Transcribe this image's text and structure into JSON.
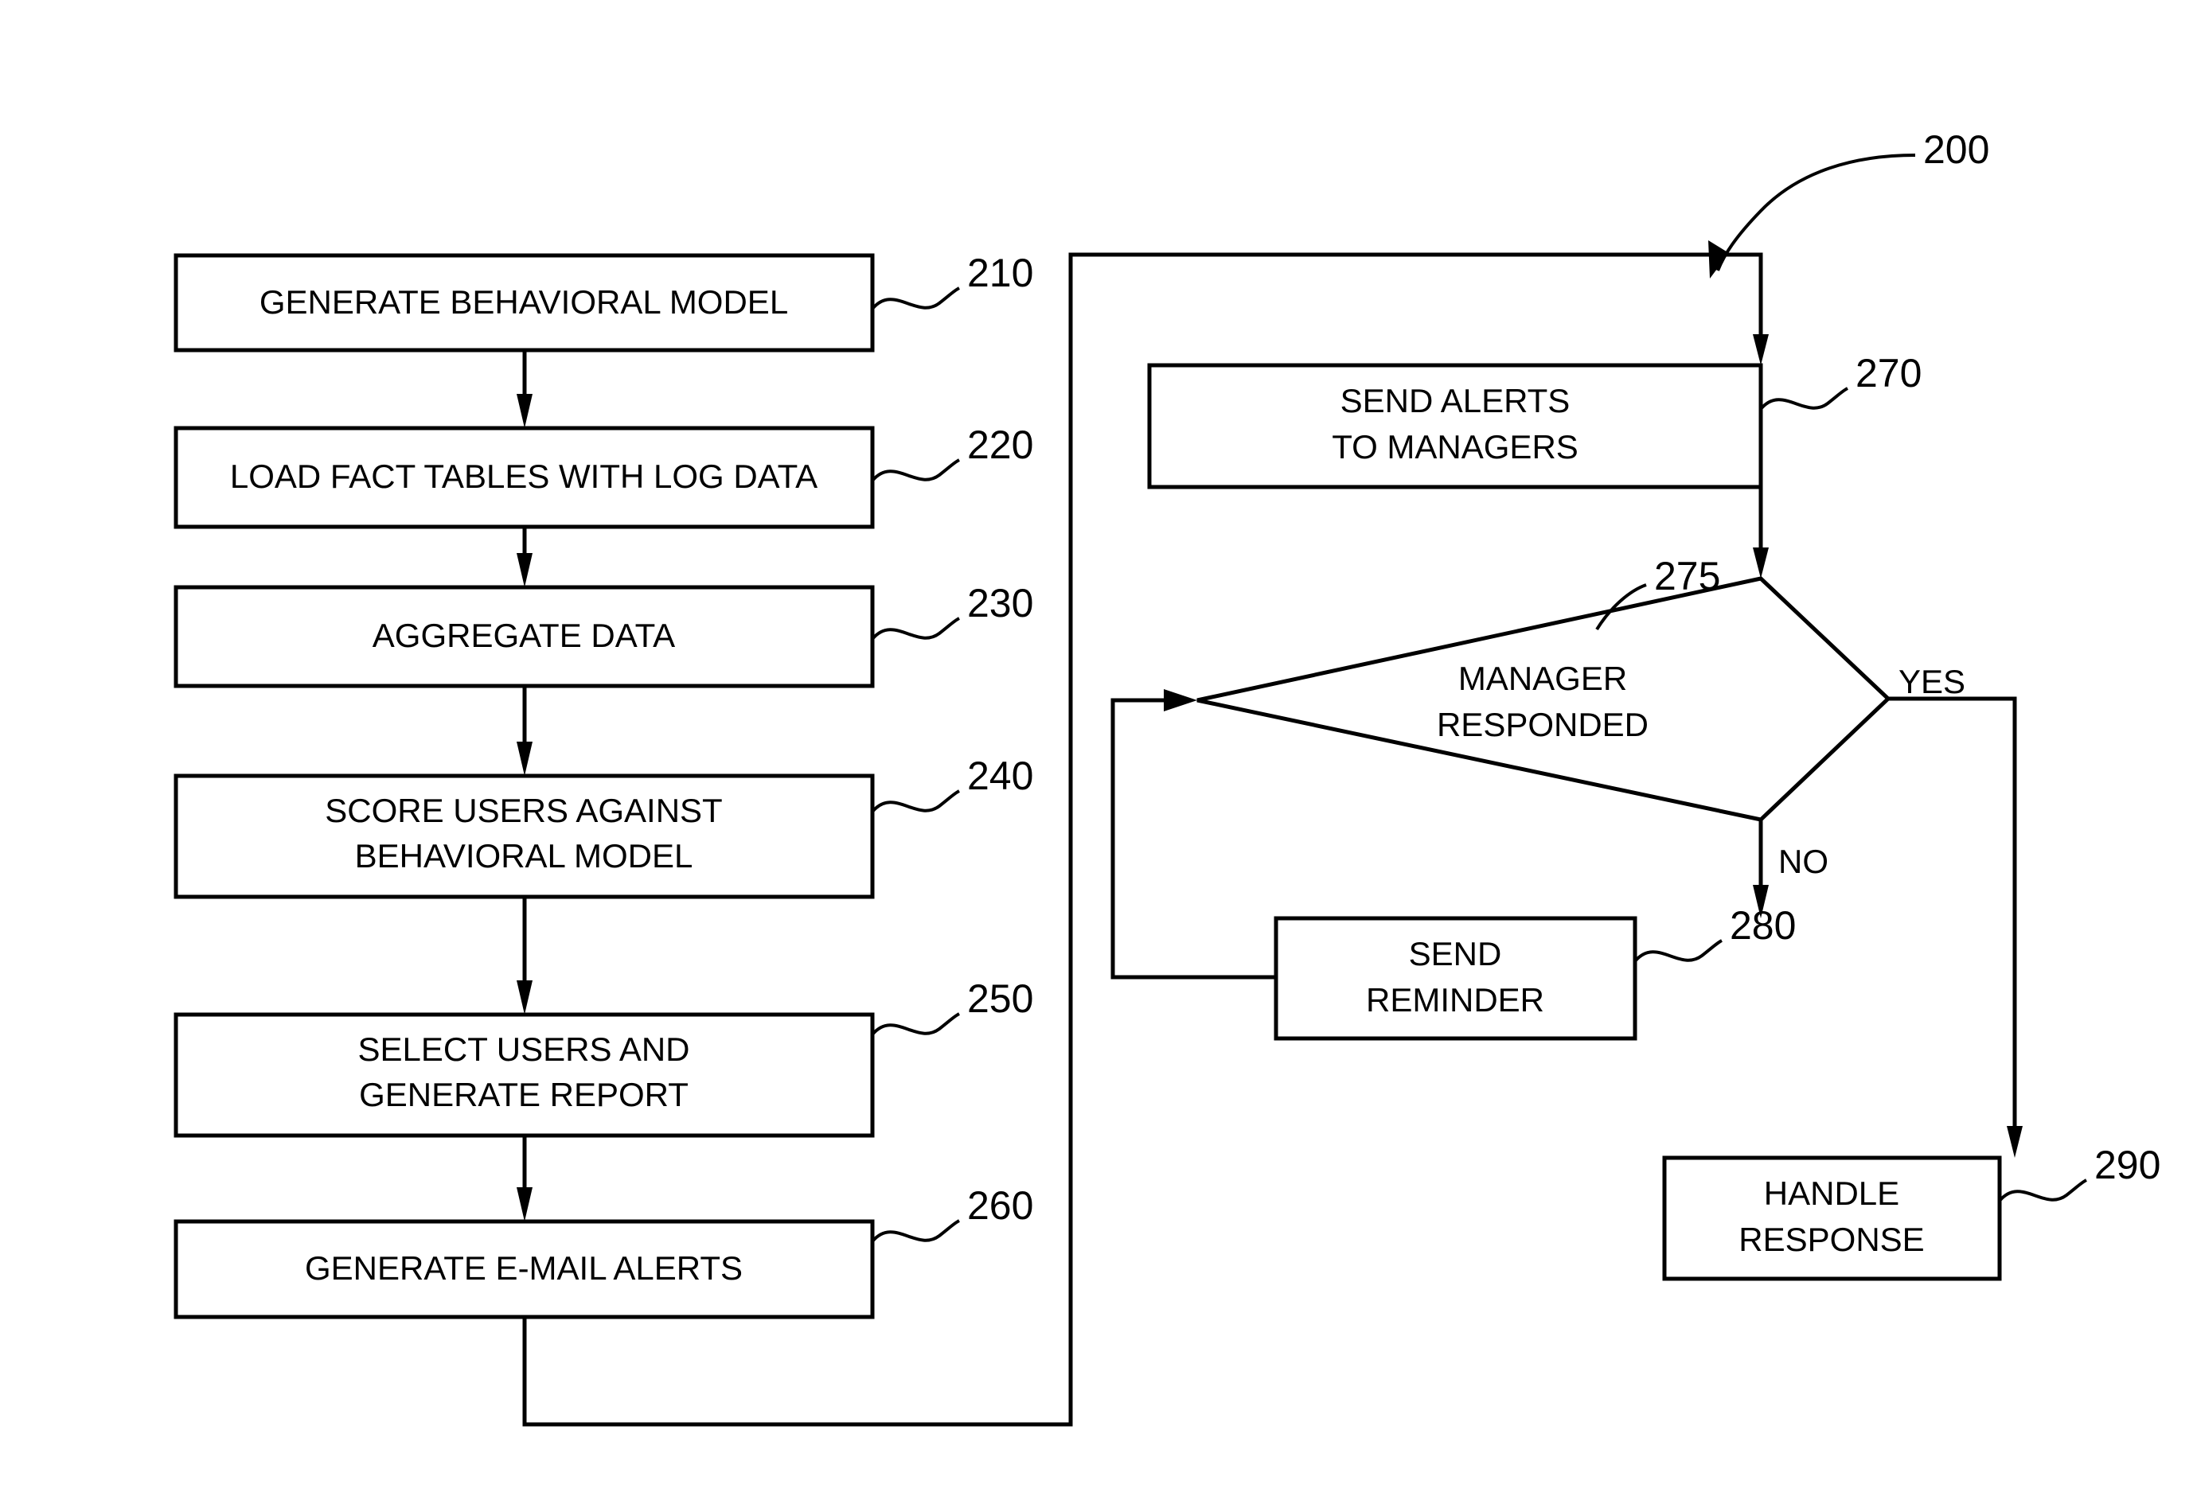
{
  "figure": {
    "figure_ref": "200",
    "title": "Behavioral model alerting process flowchart",
    "background_color": "#ffffff",
    "line_color": "#000000"
  },
  "nodes": [
    {
      "id": "210",
      "ref": "210",
      "shape": "rectangle",
      "lines": [
        "GENERATE BEHAVIORAL MODEL"
      ],
      "line1": "GENERATE BEHAVIORAL MODEL",
      "line2": ""
    },
    {
      "id": "220",
      "ref": "220",
      "shape": "rectangle",
      "lines": [
        "LOAD FACT TABLES WITH LOG DATA"
      ],
      "line1": "LOAD FACT TABLES WITH LOG DATA",
      "line2": ""
    },
    {
      "id": "230",
      "ref": "230",
      "shape": "rectangle",
      "lines": [
        "AGGREGATE DATA"
      ],
      "line1": "AGGREGATE DATA",
      "line2": ""
    },
    {
      "id": "240",
      "ref": "240",
      "shape": "rectangle",
      "lines": [
        "SCORE USERS AGAINST",
        "BEHAVIORAL MODEL"
      ],
      "line1": "SCORE USERS AGAINST",
      "line2": "BEHAVIORAL MODEL"
    },
    {
      "id": "250",
      "ref": "250",
      "shape": "rectangle",
      "lines": [
        "SELECT USERS AND",
        "GENERATE REPORT"
      ],
      "line1": "SELECT USERS AND",
      "line2": "GENERATE REPORT"
    },
    {
      "id": "260",
      "ref": "260",
      "shape": "rectangle",
      "lines": [
        "GENERATE E-MAIL ALERTS"
      ],
      "line1": "GENERATE E-MAIL ALERTS",
      "line2": ""
    },
    {
      "id": "270",
      "ref": "270",
      "shape": "rectangle",
      "lines": [
        "SEND ALERTS",
        "TO MANAGERS"
      ],
      "line1": "SEND ALERTS",
      "line2": "TO MANAGERS"
    },
    {
      "id": "275",
      "ref": "275",
      "shape": "diamond",
      "lines": [
        "MANAGER",
        "RESPONDED"
      ],
      "line1": "MANAGER",
      "line2": "RESPONDED"
    },
    {
      "id": "280",
      "ref": "280",
      "shape": "rectangle",
      "lines": [
        "SEND",
        "REMINDER"
      ],
      "line1": "SEND",
      "line2": "REMINDER"
    },
    {
      "id": "290",
      "ref": "290",
      "shape": "rectangle",
      "lines": [
        "HANDLE",
        "RESPONSE"
      ],
      "line1": "HANDLE",
      "line2": "RESPONSE"
    }
  ],
  "edge_labels": {
    "yes": "YES",
    "no": "NO"
  },
  "flow": [
    {
      "from": "210",
      "to": "220",
      "label": ""
    },
    {
      "from": "220",
      "to": "230",
      "label": ""
    },
    {
      "from": "230",
      "to": "240",
      "label": ""
    },
    {
      "from": "240",
      "to": "250",
      "label": ""
    },
    {
      "from": "250",
      "to": "260",
      "label": ""
    },
    {
      "from": "260",
      "to": "270",
      "label": ""
    },
    {
      "from": "270",
      "to": "275",
      "label": ""
    },
    {
      "from": "275",
      "to": "280",
      "label": "NO"
    },
    {
      "from": "275",
      "to": "290",
      "label": "YES"
    },
    {
      "from": "280",
      "to": "275",
      "label": ""
    }
  ]
}
